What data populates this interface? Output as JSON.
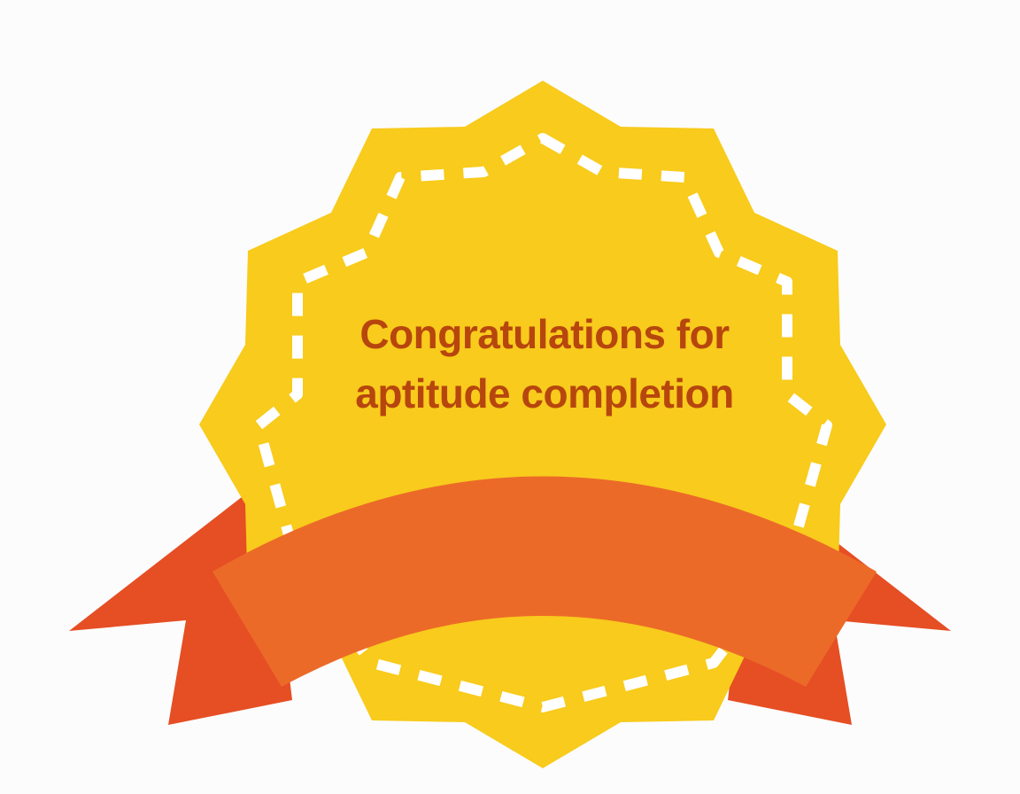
{
  "badge": {
    "text_line_1": "Congratulations for",
    "text_line_2": "aptitude completion"
  },
  "colors": {
    "background": "#fcfcfc",
    "badge_fill": "#f8cb1c",
    "stitch": "#ffffff",
    "text": "#b7460e",
    "ribbon_front": "#ec6a28",
    "ribbon_tails": "#e64e24"
  },
  "icons": {
    "badge": "scalloped-star-badge-icon",
    "ribbon": "banner-ribbon-icon"
  }
}
